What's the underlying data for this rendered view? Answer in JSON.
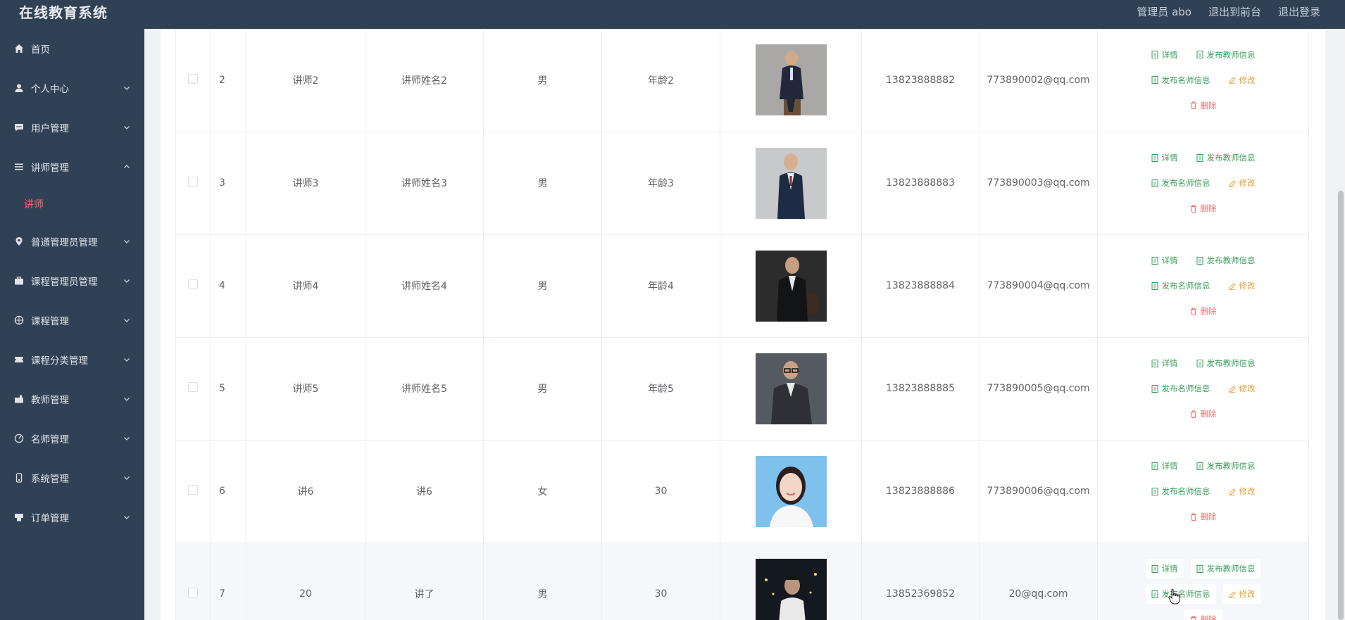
{
  "app": {
    "title": "在线教育系统"
  },
  "header": {
    "user": "管理员 abo",
    "to_front": "退出到前台",
    "logout": "退出登录"
  },
  "sidebar": {
    "items": [
      {
        "label": "首页",
        "icon": "home-icon"
      },
      {
        "label": "个人中心",
        "icon": "user-icon"
      },
      {
        "label": "用户管理",
        "icon": "chat-icon"
      },
      {
        "label": "讲师管理",
        "icon": "menu-icon",
        "expanded": true,
        "sub": "讲师"
      },
      {
        "label": "普通管理员管理",
        "icon": "location-icon"
      },
      {
        "label": "课程管理员管理",
        "icon": "briefcase-icon"
      },
      {
        "label": "课程管理",
        "icon": "basketball-icon"
      },
      {
        "label": "课程分类管理",
        "icon": "ticket-icon"
      },
      {
        "label": "教师管理",
        "icon": "post-icon"
      },
      {
        "label": "名师管理",
        "icon": "dashboard-icon"
      },
      {
        "label": "系统管理",
        "icon": "lock-icon"
      },
      {
        "label": "订单管理",
        "icon": "printer-icon"
      }
    ]
  },
  "table": {
    "actions": {
      "detail": "详情",
      "publish_teacher": "发布教师信息",
      "publish_famous": "发布名师信息",
      "edit": "修改",
      "delete": "删除"
    },
    "rows": [
      {
        "index": "2",
        "account": "讲师2",
        "name": "讲师姓名2",
        "gender": "男",
        "age": "年龄2",
        "photo": "portrait-suit-sitting",
        "phone": "13823888882",
        "email": "773890002@qq.com"
      },
      {
        "index": "3",
        "account": "讲师3",
        "name": "讲师姓名3",
        "gender": "男",
        "age": "年龄3",
        "photo": "portrait-suit-vest",
        "phone": "13823888883",
        "email": "773890003@qq.com"
      },
      {
        "index": "4",
        "account": "讲师4",
        "name": "讲师姓名4",
        "gender": "男",
        "age": "年龄4",
        "photo": "portrait-dark-suit",
        "phone": "13823888884",
        "email": "773890004@qq.com"
      },
      {
        "index": "5",
        "account": "讲师5",
        "name": "讲师姓名5",
        "gender": "男",
        "age": "年龄5",
        "photo": "portrait-glasses",
        "phone": "13823888885",
        "email": "773890005@qq.com"
      },
      {
        "index": "6",
        "account": "讲6",
        "name": "讲6",
        "gender": "女",
        "age": "30",
        "photo": "portrait-woman-blue",
        "phone": "13823888886",
        "email": "773890006@qq.com"
      },
      {
        "index": "7",
        "account": "20",
        "name": "讲了",
        "gender": "男",
        "age": "30",
        "photo": "portrait-night",
        "phone": "13852369852",
        "email": "20@qq.com"
      }
    ]
  },
  "colors": {
    "sidebar_bg": "#304156",
    "active_sub": "#f56c6c",
    "action_green": "#3a9d5d",
    "action_orange": "#e6a23c",
    "action_red": "#f56c6c"
  }
}
